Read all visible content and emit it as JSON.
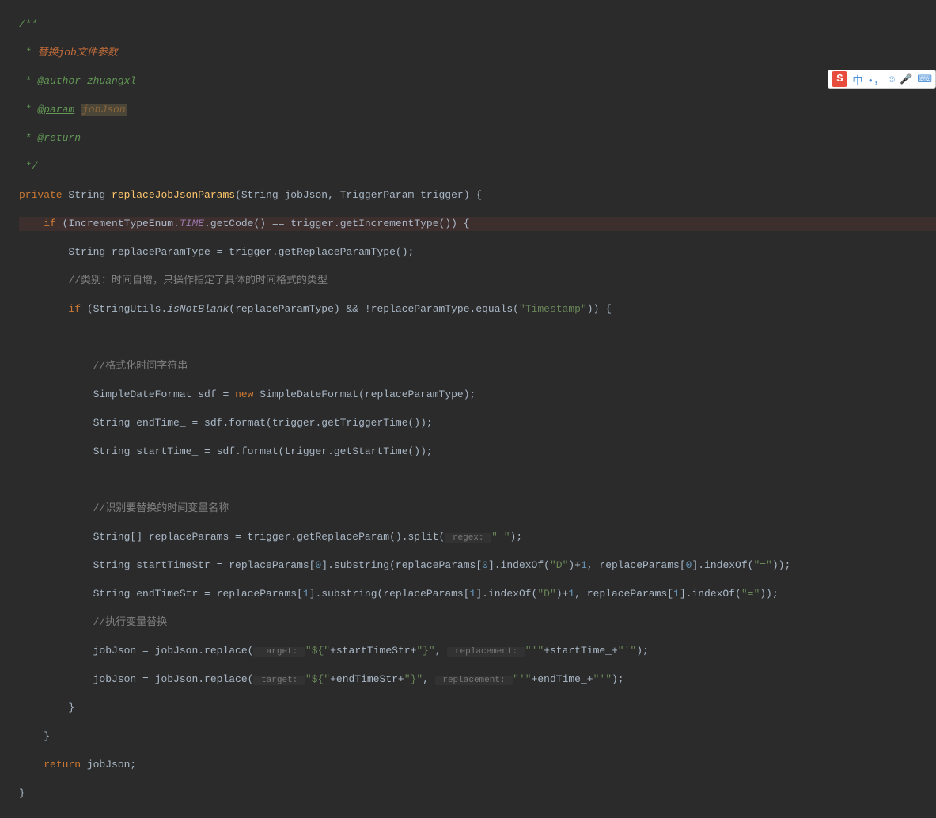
{
  "code": {
    "l1": "/**",
    "l2_star": " * ",
    "l2_txt": "替换job文件参数",
    "l3_star": " * ",
    "l3_tag": "@author",
    "l3_val": " zhuangxl",
    "l4_star": " * ",
    "l4_tag": "@param",
    "l4_val": "jobJson",
    "l5_star": " * ",
    "l5_tag": "@return",
    "l6": " */",
    "l7_kw1": "private ",
    "l7_type": "String ",
    "l7_method": "replaceJobJsonParams",
    "l7_rest": "(String jobJson, TriggerParam trigger) {",
    "l8_indent": "    ",
    "l8_kw": "if ",
    "l8_p1": "(IncrementTypeEnum.",
    "l8_sf": "TIME",
    "l8_p2": ".getCode() == trigger.getIncrementType()) {",
    "l9_indent": "        ",
    "l9_txt": "String replaceParamType = trigger.getReplaceParamType();",
    "l10_indent": "        ",
    "l10_c": "//类别：时间自增，只操作指定了具体的时间格式的类型",
    "l11_indent": "        ",
    "l11_kw": "if ",
    "l11_p1": "(StringUtils.",
    "l11_sm": "isNotBlank",
    "l11_p2": "(replaceParamType) && !replaceParamType.equals(",
    "l11_str": "\"Timestamp\"",
    "l11_p3": ")) {",
    "l13_indent": "            ",
    "l13_c": "//格式化时间字符串",
    "l14_indent": "            ",
    "l14_p1": "SimpleDateFormat sdf = ",
    "l14_kw": "new ",
    "l14_p2": "SimpleDateFormat(replaceParamType);",
    "l15_indent": "            ",
    "l15_txt": "String endTime_ = sdf.format(trigger.getTriggerTime());",
    "l16_indent": "            ",
    "l16_txt": "String startTime_ = sdf.format(trigger.getStartTime());",
    "l18_indent": "            ",
    "l18_c": "//识别要替换的时间变量名称",
    "l19_indent": "            ",
    "l19_p1": "String[] replaceParams = trigger.getReplaceParam().split(",
    "l19_hint": " regex: ",
    "l19_str": "\" \"",
    "l19_p2": ");",
    "l20_indent": "            ",
    "l20_p1": "String startTimeStr = replaceParams[",
    "l20_n0a": "0",
    "l20_p2": "].substring(replaceParams[",
    "l20_n0b": "0",
    "l20_p3": "].indexOf(",
    "l20_str1": "\"D\"",
    "l20_p4": ")+",
    "l20_n1": "1",
    "l20_p5": ", replaceParams[",
    "l20_n0c": "0",
    "l20_p6": "].indexOf(",
    "l20_str2": "\"=\"",
    "l20_p7": "));",
    "l21_indent": "            ",
    "l21_p1": "String endTimeStr = replaceParams[",
    "l21_n1a": "1",
    "l21_p2": "].substring(replaceParams[",
    "l21_n1b": "1",
    "l21_p3": "].indexOf(",
    "l21_str1": "\"D\"",
    "l21_p4": ")+",
    "l21_n1": "1",
    "l21_p5": ", replaceParams[",
    "l21_n1c": "1",
    "l21_p6": "].indexOf(",
    "l21_str2": "\"=\"",
    "l21_p7": "));",
    "l22_indent": "            ",
    "l22_c": "//执行变量替换",
    "l23_indent": "            ",
    "l23_p1": "jobJson = jobJson.replace(",
    "l23_hint1": " target: ",
    "l23_str1": "\"${\"",
    "l23_p2": "+startTimeStr+",
    "l23_str2": "\"}\"",
    "l23_p3": ", ",
    "l23_hint2": " replacement: ",
    "l23_str3": "\"'\"",
    "l23_p4": "+startTime_+",
    "l23_str4": "\"'\"",
    "l23_p5": ");",
    "l24_indent": "            ",
    "l24_p1": "jobJson = jobJson.replace(",
    "l24_hint1": " target: ",
    "l24_str1": "\"${\"",
    "l24_p2": "+endTimeStr+",
    "l24_str2": "\"}\"",
    "l24_p3": ", ",
    "l24_hint2": " replacement: ",
    "l24_str3": "\"'\"",
    "l24_p4": "+endTime_+",
    "l24_str4": "\"'\"",
    "l24_p5": ");",
    "l25": "        }",
    "l26": "    }",
    "l27_indent": "    ",
    "l27_kw": "return ",
    "l27_p": "jobJson;",
    "l28": "}"
  },
  "ime": {
    "logo": "S",
    "lang": "中",
    "punct": "•，",
    "emoji": "☺",
    "mic": "🎤",
    "kbd": "⌨"
  }
}
